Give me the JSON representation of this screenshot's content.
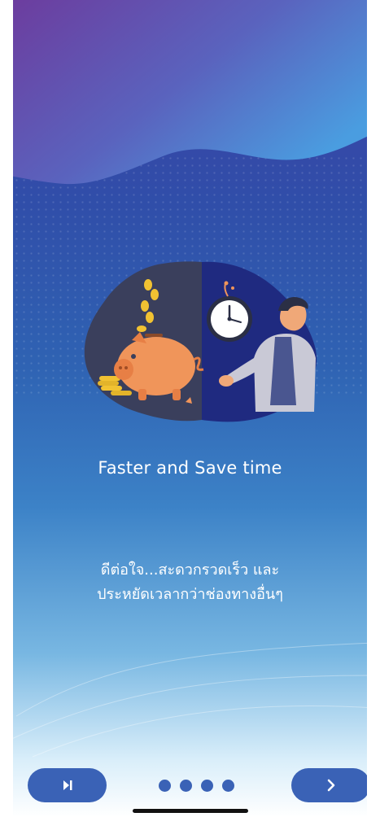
{
  "onboarding": {
    "title": "Faster and Save time",
    "description_line1": "ดีต่อใจ...สะดวกรวดเร็ว และ",
    "description_line2": "ประหยัดเวลากว่าช่องทางอื่นๆ",
    "illustration": "piggy-bank-coins-clock-man",
    "skip_icon": "skip-forward-icon",
    "next_icon": "chevron-right-icon",
    "pager": {
      "total_pages": 4
    }
  },
  "colors": {
    "button": "#3a62b6",
    "background_top": "#3e3fa6",
    "background_bottom": "#ffffff",
    "wave_purple": "#6d3b9d",
    "wave_blue": "#4a9de0"
  }
}
